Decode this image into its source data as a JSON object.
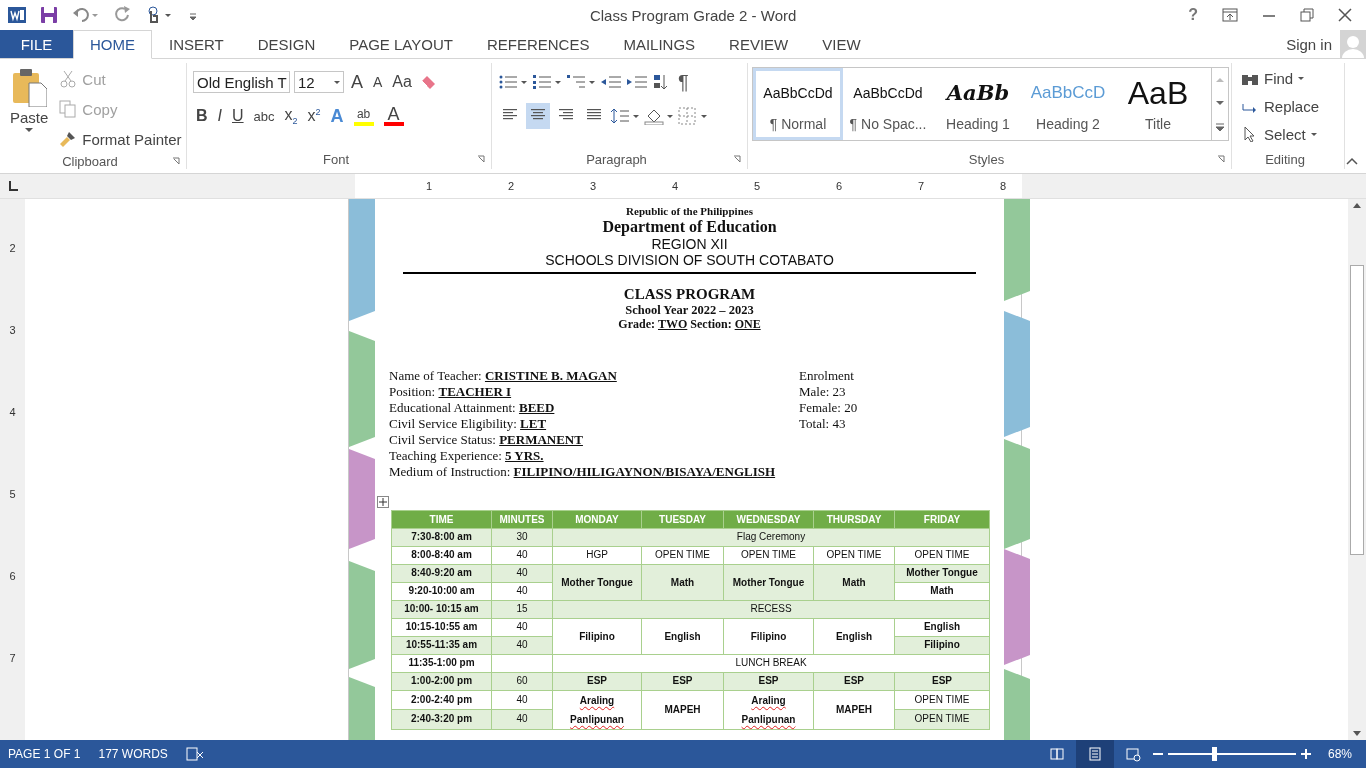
{
  "window": {
    "title": "Class Program Grade 2 - Word",
    "help": "?"
  },
  "ribbon_tabs": [
    {
      "label": "FILE",
      "kind": "file",
      "selected": false
    },
    {
      "label": "HOME",
      "kind": "tab",
      "selected": true
    },
    {
      "label": "INSERT",
      "kind": "tab",
      "selected": false
    },
    {
      "label": "DESIGN",
      "kind": "tab",
      "selected": false
    },
    {
      "label": "PAGE LAYOUT",
      "kind": "tab",
      "selected": false
    },
    {
      "label": "REFERENCES",
      "kind": "tab",
      "selected": false
    },
    {
      "label": "MAILINGS",
      "kind": "tab",
      "selected": false
    },
    {
      "label": "REVIEW",
      "kind": "tab",
      "selected": false
    },
    {
      "label": "VIEW",
      "kind": "tab",
      "selected": false
    }
  ],
  "account": {
    "label": "Sign in"
  },
  "clipboard": {
    "paste": "Paste",
    "label": "Clipboard",
    "actions": [
      {
        "kind": "cut",
        "label": "Cut",
        "disabled": true
      },
      {
        "kind": "copy",
        "label": "Copy",
        "disabled": true
      },
      {
        "kind": "painter",
        "label": "Format Painter",
        "disabled": false
      }
    ]
  },
  "font": {
    "name": "Old English T",
    "size": "12",
    "label": "Font",
    "case_button": "Aa",
    "size_buttons": [
      {
        "kind": "grow",
        "label": "A"
      },
      {
        "kind": "shrink",
        "label": "A"
      }
    ],
    "format_buttons": [
      {
        "kind": "bold",
        "label": "B"
      },
      {
        "kind": "italic",
        "label": "I"
      },
      {
        "kind": "underline",
        "label": "U"
      },
      {
        "kind": "strike",
        "label": "abc"
      },
      {
        "kind": "subscript",
        "label": "x$_{2}$"
      },
      {
        "kind": "superscript",
        "label": "x$^{2}$"
      }
    ],
    "color_buttons": [
      {
        "kind": "effects",
        "label": "A"
      },
      {
        "kind": "highlight",
        "label": "ab",
        "color": "#ffff00"
      },
      {
        "kind": "font-color",
        "label": "A",
        "color": "#ff0000"
      }
    ]
  },
  "paragraph": {
    "label": "Paragraph",
    "pilcrow": "¶",
    "alignment": [
      {
        "kind": "left",
        "selected": false
      },
      {
        "kind": "center",
        "selected": true
      },
      {
        "kind": "right",
        "selected": false
      },
      {
        "kind": "justify",
        "selected": false
      }
    ]
  },
  "styles": {
    "label": "Styles",
    "items": [
      {
        "kind": "normal",
        "preview": "AaBbCcDd",
        "label": "¶ Normal",
        "selected": true
      },
      {
        "kind": "no-spacing",
        "preview": "AaBbCcDd",
        "label": "¶ No Spac...",
        "selected": false
      },
      {
        "kind": "heading1",
        "preview": "AaBb",
        "label": "Heading 1",
        "selected": false
      },
      {
        "kind": "heading2",
        "preview": "AaBbCcD",
        "label": "Heading 2",
        "selected": false
      },
      {
        "kind": "title",
        "preview": "AaB",
        "label": "Title",
        "selected": false
      }
    ]
  },
  "editing": {
    "label": "Editing",
    "actions": [
      {
        "kind": "find",
        "label": "Find"
      },
      {
        "kind": "replace",
        "label": "Replace"
      },
      {
        "kind": "select",
        "label": "Select"
      }
    ]
  },
  "ruler": {
    "marks": [
      "1",
      "2",
      "3",
      "4",
      "5",
      "6",
      "7",
      "8"
    ]
  },
  "vertical_ruler": {
    "marks": [
      "2",
      "3",
      "4",
      "5",
      "6",
      "7"
    ]
  },
  "document": {
    "header": {
      "republic": "Republic of the Philippines",
      "department": "Department of Education",
      "region": "REGION XII",
      "division": "SCHOOLS DIVISION OF SOUTH COTABATO"
    },
    "title": "CLASS PROGRAM",
    "school_year": "School Year 2022 – 2023",
    "grade_line": "Grade: **TWO** Section: **ONE**",
    "teacher_info": [
      "Name of Teacher: **CRISTINE B. MAGAN**",
      "Position: **TEACHER I**",
      "Educational Attainment: **BEED**",
      "Civil Service Eligibility: **LET**",
      "Civil Service Status: **PERMANENT**",
      "Teaching Experience: **5 YRS.**",
      "Medium of Instruction: **FILIPINO/HILIGAYNON/BISAYA/ENGLISH**"
    ],
    "enrolment": [
      "Enrolment",
      "Male: 23",
      "Female: 20",
      "Total: 43"
    ],
    "schedule": {
      "columns": [
        "TIME",
        "MINUTES",
        "MONDAY",
        "TUESDAY",
        "WEDNESDAY",
        "THURSDAY",
        "FRIDAY"
      ],
      "rows": [
        {
          "shaded": true,
          "cells": [
            {
              "text": "7:30-8:00 am",
              "bold": true
            },
            {
              "text": "30",
              "bold": false
            },
            {
              "text": "Flag Ceremony",
              "bold": false,
              "colspan": 5
            }
          ]
        },
        {
          "shaded": false,
          "cells": [
            {
              "text": "8:00-8:40 am",
              "bold": true
            },
            {
              "text": "40",
              "bold": false
            },
            {
              "text": "HGP",
              "bold": false
            },
            {
              "text": "OPEN TIME",
              "bold": false
            },
            {
              "text": "OPEN TIME",
              "bold": false
            },
            {
              "text": "OPEN TIME",
              "bold": false
            },
            {
              "text": "OPEN TIME",
              "bold": false
            }
          ]
        },
        {
          "shaded": true,
          "cells": [
            {
              "text": "8:40-9:20 am",
              "bold": true
            },
            {
              "text": "40",
              "bold": false
            },
            {
              "text": "Mother Tongue",
              "bold": true,
              "rowspan": 2
            },
            {
              "text": "Math",
              "bold": true,
              "rowspan": 2
            },
            {
              "text": "Mother Tongue",
              "bold": true,
              "rowspan": 2
            },
            {
              "text": "Math",
              "bold": true,
              "rowspan": 2
            },
            {
              "text": "Mother Tongue",
              "bold": true
            }
          ]
        },
        {
          "shaded": false,
          "cells": [
            {
              "text": "9:20-10:00 am",
              "bold": true
            },
            {
              "text": "40",
              "bold": false
            },
            {
              "text": "Math",
              "bold": true
            }
          ]
        },
        {
          "shaded": true,
          "cells": [
            {
              "text": "10:00- 10:15 am",
              "bold": true
            },
            {
              "text": "15",
              "bold": false
            },
            {
              "text": "RECESS",
              "bold": false,
              "colspan": 5
            }
          ]
        },
        {
          "shaded": false,
          "cells": [
            {
              "text": "10:15-10:55 am",
              "bold": true
            },
            {
              "text": "40",
              "bold": false
            },
            {
              "text": "Filipino",
              "bold": true,
              "rowspan": 2
            },
            {
              "text": "English",
              "bold": true,
              "rowspan": 2
            },
            {
              "text": "Filipino",
              "bold": true,
              "rowspan": 2
            },
            {
              "text": "English",
              "bold": true,
              "rowspan": 2
            },
            {
              "text": "English",
              "bold": true
            }
          ]
        },
        {
          "shaded": true,
          "cells": [
            {
              "text": "10:55-11:35 am",
              "bold": true
            },
            {
              "text": "40",
              "bold": false
            },
            {
              "text": "Filipino",
              "bold": true
            }
          ]
        },
        {
          "shaded": false,
          "cells": [
            {
              "text": "11:35-1:00 pm",
              "bold": true
            },
            {
              "bold": false
            },
            {
              "text": "LUNCH BREAK",
              "bold": false,
              "colspan": 5
            }
          ]
        },
        {
          "shaded": true,
          "cells": [
            {
              "text": "1:00-2:00 pm",
              "bold": true
            },
            {
              "text": "60",
              "bold": false
            },
            {
              "text": "ESP",
              "bold": true
            },
            {
              "text": "ESP",
              "bold": true
            },
            {
              "text": "ESP",
              "bold": true
            },
            {
              "text": "ESP",
              "bold": true
            },
            {
              "text": "ESP",
              "bold": true
            }
          ]
        },
        {
          "shaded": false,
          "cells": [
            {
              "text": "2:00-2:40 pm",
              "bold": true
            },
            {
              "text": "40",
              "bold": false
            },
            {
              "text": "Araling Panlipunan",
              "bold": true,
              "rowspan": 2,
              "spell_error": true
            },
            {
              "text": "MAPEH",
              "bold": true,
              "rowspan": 2
            },
            {
              "text": "Araling Panlipunan",
              "bold": true,
              "rowspan": 2,
              "spell_error": true
            },
            {
              "text": "MAPEH",
              "bold": true,
              "rowspan": 2
            },
            {
              "text": "OPEN TIME",
              "bold": false
            }
          ]
        },
        {
          "shaded": true,
          "cells": [
            {
              "text": "2:40-3:20 pm",
              "bold": true
            },
            {
              "text": "40",
              "bold": false
            },
            {
              "text": "OPEN TIME",
              "bold": false
            }
          ]
        }
      ]
    }
  },
  "status_bar": {
    "page": "PAGE 1 OF 1",
    "words": "177 WORDS",
    "views": [
      {
        "kind": "read",
        "selected": false
      },
      {
        "kind": "print",
        "selected": true
      },
      {
        "kind": "web",
        "selected": false
      }
    ],
    "zoom": {
      "level": 0.36,
      "reading": "68%"
    }
  }
}
